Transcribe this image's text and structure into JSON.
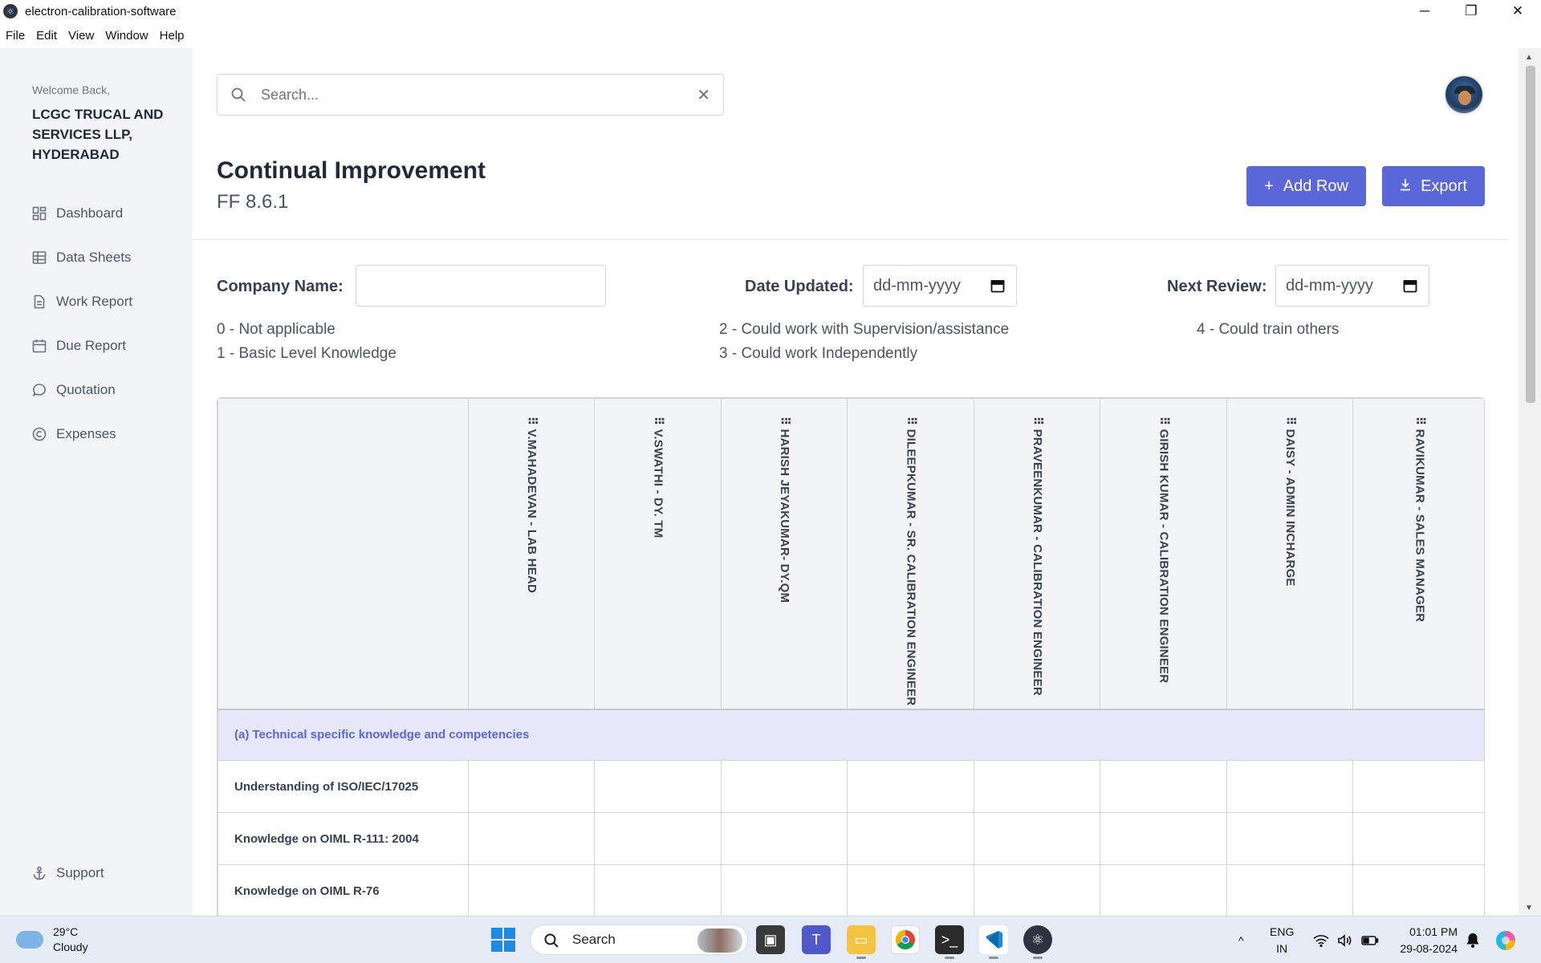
{
  "window": {
    "title": "electron-calibration-software",
    "minimize": "─",
    "maximize": "❐",
    "close": "✕"
  },
  "menu": [
    "File",
    "Edit",
    "View",
    "Window",
    "Help"
  ],
  "sidebar": {
    "welcome": "Welcome Back,",
    "company": "LCGC TRUCAL AND SERVICES LLP, HYDERABAD",
    "items": [
      {
        "label": "Dashboard",
        "icon": "dashboard-icon"
      },
      {
        "label": "Data Sheets",
        "icon": "table-icon"
      },
      {
        "label": "Work Report",
        "icon": "document-icon"
      },
      {
        "label": "Due Report",
        "icon": "calendar-icon"
      },
      {
        "label": "Quotation",
        "icon": "chat-icon"
      },
      {
        "label": "Expenses",
        "icon": "copyright-icon"
      }
    ],
    "support": "Support"
  },
  "search": {
    "placeholder": "Search..."
  },
  "page": {
    "title": "Continual Improvement",
    "subtitle": "FF 8.6.1",
    "add_row": "Add Row",
    "export": "Export"
  },
  "form": {
    "company_label": "Company Name:",
    "company_value": "",
    "date_updated_label": "Date Updated:",
    "date_updated_value": "dd-mm-yyyy",
    "next_review_label": "Next Review:",
    "next_review_value": "dd-mm-yyyy"
  },
  "legend": [
    "0 - Not applicable",
    "1 - Basic Level Knowledge",
    "2 - Could work with Supervision/assistance",
    "3 - Could work Independently",
    "4 - Could train others"
  ],
  "table": {
    "columns": [
      "V.MAHADEVAN - LAB HEAD",
      "V.SWATHI - DY. TM",
      "HARISH JEYAKUMAR- DY.QM",
      "DILEEPKUMAR - SR. CALIBRATION ENGINEER",
      "PRAVEENKUMAR - CALIBRATION ENGINEER",
      "GIRISH KUMAR - CALIBRATION ENGINEER",
      "DAISY - ADMIN INCHARGE",
      "RAVIKUMAR - SALES MANAGER"
    ],
    "drag_handle": "⠿",
    "section": "(a) Technical specific knowledge and competencies",
    "rows": [
      "Understanding of ISO/IEC/17025",
      "Knowledge on OIML R-111: 2004",
      "Knowledge on OIML R-76"
    ]
  },
  "taskbar": {
    "weather_temp": "29°C",
    "weather_desc": "Cloudy",
    "search_label": "Search",
    "lang_1": "ENG",
    "lang_2": "IN",
    "time": "01:01 PM",
    "date": "29-08-2024"
  }
}
